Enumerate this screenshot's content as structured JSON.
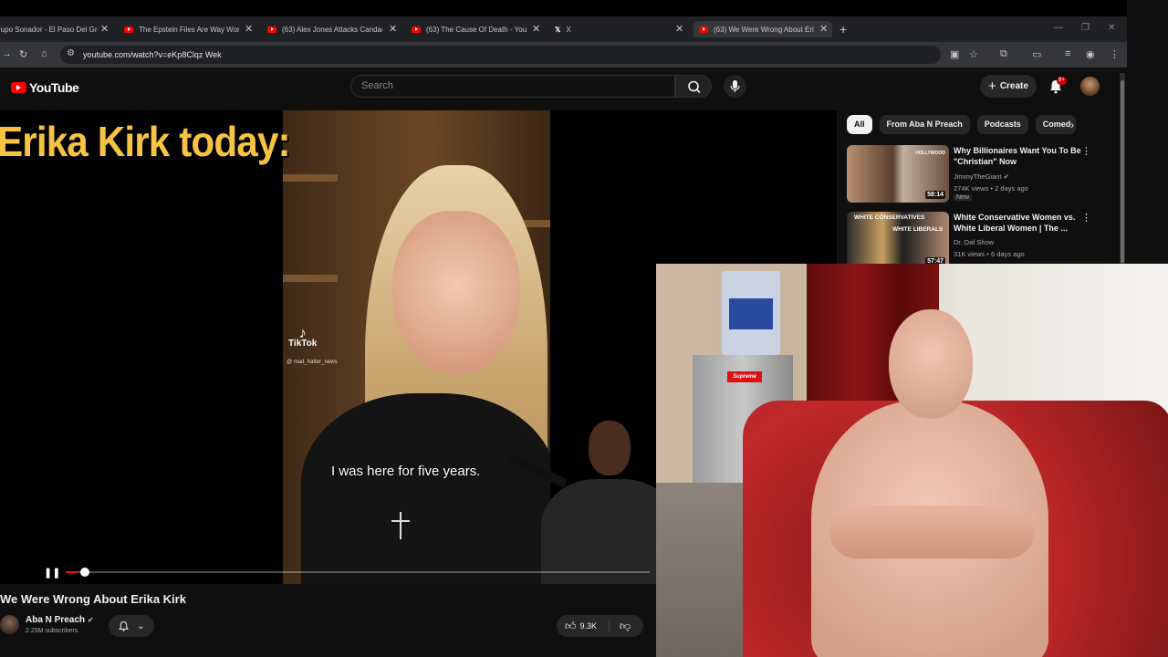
{
  "browser": {
    "tabs": [
      {
        "label": "rupo Sonador - El Paso Del Gr"
      },
      {
        "label": "The Epstein Files Are Way Wors"
      },
      {
        "label": "(63) Alex Jones Attacks Candac"
      },
      {
        "label": "(63) The Cause Of Death - YouT"
      },
      {
        "label": "X"
      },
      {
        "label": "(63) We Were Wrong About Eri"
      }
    ],
    "url": "youtube.com/watch?v=eKp8Clqz Wek"
  },
  "youtube": {
    "logo_text": "YouTube",
    "search_placeholder": "Search",
    "create_label": "Create",
    "notif_count": "9+"
  },
  "video": {
    "headline": "Erika Kirk today:",
    "tiktok_brand": "TikTok",
    "tiktok_handle": "@ mad_hatter_news",
    "subtitle": "I was here for five years.",
    "progress": 0.02,
    "title": "We Were Wrong About Erika Kirk",
    "channel": "Aba N Preach",
    "subscribers": "2.25M subscribers",
    "likes": "9.3K"
  },
  "chips": [
    {
      "label": "All",
      "selected": true
    },
    {
      "label": "From Aba N Preach",
      "selected": false
    },
    {
      "label": "Podcasts",
      "selected": false
    },
    {
      "label": "Comed",
      "selected": false
    }
  ],
  "recommendations": [
    {
      "title": "Why Billionaires Want You To Be \"Christian\" Now",
      "channel": "JimmyTheGiant",
      "meta": "274K views • 2 days ago",
      "badge": "New",
      "duration": "58:14",
      "thumb_overlay": "HOLLYWOOD"
    },
    {
      "title": "White Conservative Women vs. White Liberal Women | The ...",
      "channel": "Dr. Daf Show",
      "meta": "31K views • 6 days ago",
      "duration": "57:47",
      "thumb_overlay": "WHITE CONSERVATIVES",
      "thumb_overlay2": "WHITE LIBERALS"
    }
  ],
  "webcam": {
    "sticker": "Supreme"
  }
}
